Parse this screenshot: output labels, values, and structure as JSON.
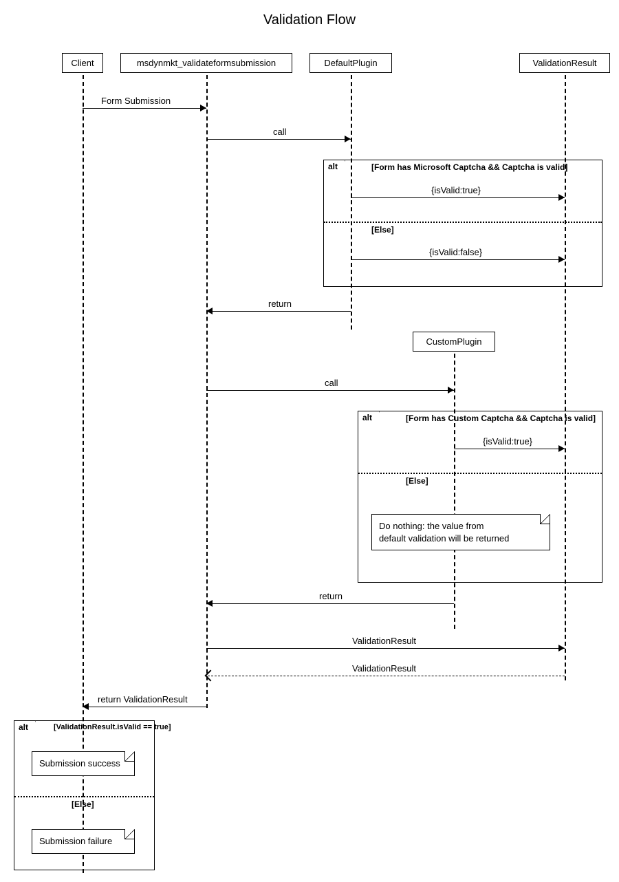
{
  "title": "Validation Flow",
  "participants": {
    "client": "Client",
    "validate": "msdynmkt_validateformsubmission",
    "default_plugin": "DefaultPlugin",
    "custom_plugin": "CustomPlugin",
    "validation_result": "ValidationResult"
  },
  "messages": {
    "form_submission": "Form Submission",
    "call1": "call",
    "return1": "return",
    "is_valid_true": "{isValid:true}",
    "is_valid_false": "{isValid:false}",
    "call2": "call",
    "is_valid_true2": "{isValid:true}",
    "return2": "return",
    "validation_result_msg1": "ValidationResult",
    "validation_result_msg2": "ValidationResult",
    "return_validation_result": "return ValidationResult"
  },
  "alt1": {
    "tag": "alt",
    "guard1": "[Form has Microsoft Captcha && Captcha is valid]",
    "else": "[Else]"
  },
  "alt2": {
    "tag": "alt",
    "guard1": "[Form has Custom Captcha && Captcha is valid]",
    "else": "[Else]",
    "note": "Do nothing: the value from\ndefault validation will be returned"
  },
  "alt3": {
    "tag": "alt",
    "guard1": "[ValidationResult.isValid == true]",
    "else": "[Else]",
    "note_success": "Submission success",
    "note_failure": "Submission failure"
  }
}
